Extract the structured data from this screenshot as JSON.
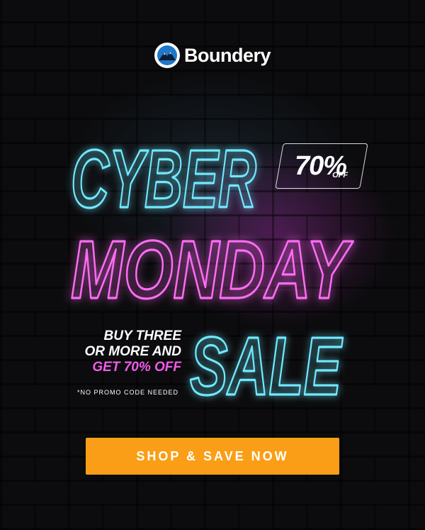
{
  "brand": {
    "name": "Boundery"
  },
  "headline": {
    "line1": "CYBER",
    "line2": "MONDAY",
    "line3": "SALE"
  },
  "badge": {
    "percent": "70%",
    "off": "OFF"
  },
  "promo": {
    "line1": "BUY THREE",
    "line2": "OR MORE AND",
    "line3": "GET 70% OFF",
    "note": "*NO PROMO CODE NEEDED"
  },
  "cta": {
    "label": "SHOP & SAVE NOW"
  },
  "colors": {
    "neon_blue": "#6fe9ff",
    "neon_pink": "#ff6cf3",
    "cta": "#f99e16",
    "accent_pink": "#f05be8"
  }
}
